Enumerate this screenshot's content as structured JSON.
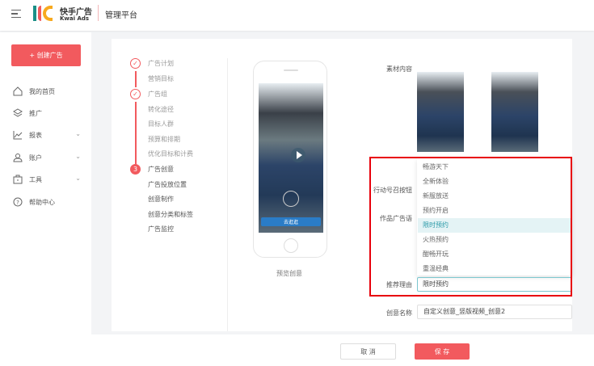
{
  "header": {
    "brand_cn": "快手广告",
    "brand_en": "Kwai Ads",
    "platform": "管理平台"
  },
  "sidebar": {
    "create_label": "+ 创建广告",
    "items": [
      {
        "label": "我的首页",
        "icon": "home-icon"
      },
      {
        "label": "推广",
        "icon": "layers-icon"
      },
      {
        "label": "报表",
        "icon": "chart-icon",
        "chevron": true
      },
      {
        "label": "账户",
        "icon": "user-icon",
        "chevron": true
      },
      {
        "label": "工具",
        "icon": "toolbox-icon",
        "chevron": true
      },
      {
        "label": "帮助中心",
        "icon": "help-icon"
      }
    ]
  },
  "steps": {
    "s1": "广告计划",
    "s1a": "营销目标",
    "s2": "广告组",
    "s2a": "转化途径",
    "s2b": "目标人群",
    "s2c": "预算和排期",
    "s2d": "优化目标和计费",
    "s3_num": "3",
    "s3": "广告创意",
    "s3a": "广告投放位置",
    "s3b": "创意制作",
    "s3c": "创意分类和标签",
    "s3d": "广告监控"
  },
  "preview": {
    "cta": "去逛逛",
    "label": "预览创意"
  },
  "form": {
    "material_label": "素材内容",
    "cta_label": "行动号召按钮",
    "slogan_label": "作品广告语",
    "reason_label": "推荐理由",
    "reason_value": "限时预约",
    "name_label": "创意名称",
    "name_value": "自定义创意_竖版视频_创意2"
  },
  "dropdown": {
    "options": [
      "畅游天下",
      "全新体验",
      "新服放送",
      "预约开启",
      "限时预约",
      "火热预约",
      "酣畅开玩",
      "重温经典"
    ],
    "selected_index": 4
  },
  "footer": {
    "cancel": "取 消",
    "save": "保 存"
  },
  "colors": {
    "accent": "#f25a5e",
    "highlight": "#2a9aa8",
    "annotation": "#e8000b"
  }
}
